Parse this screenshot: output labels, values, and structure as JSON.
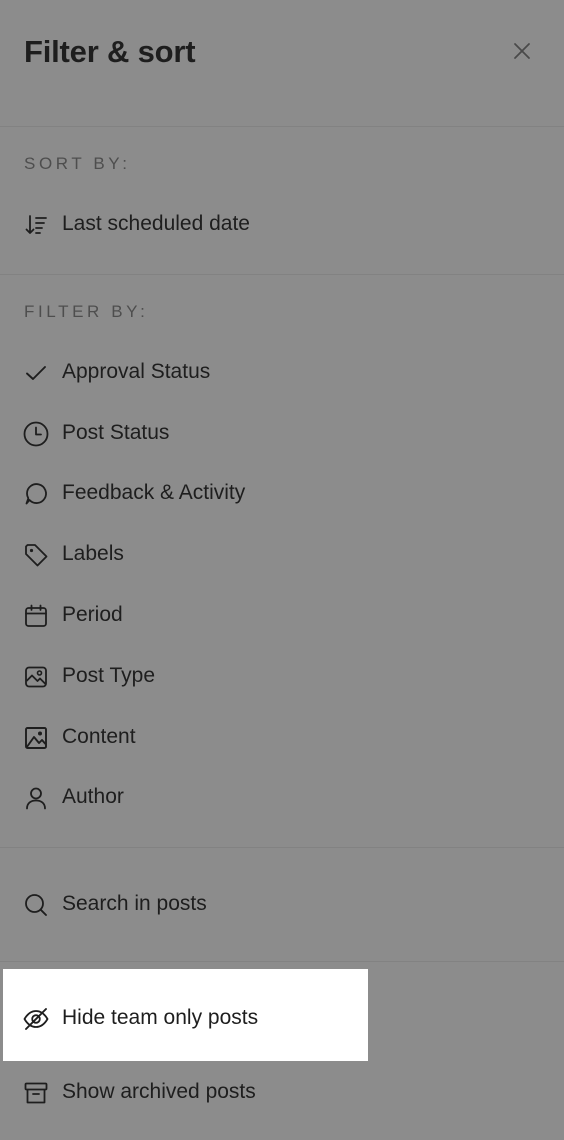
{
  "header": {
    "title": "Filter & sort",
    "close_icon": "close-icon"
  },
  "sort": {
    "label": "SORT BY:",
    "option": {
      "label": "Last scheduled date",
      "icon": "sort-descending-icon"
    }
  },
  "filter": {
    "label": "FILTER BY:",
    "items": [
      {
        "label": "Approval Status",
        "icon": "check-icon"
      },
      {
        "label": "Post Status",
        "icon": "clock-icon"
      },
      {
        "label": "Feedback & Activity",
        "icon": "comment-icon"
      },
      {
        "label": "Labels",
        "icon": "tag-icon"
      },
      {
        "label": "Period",
        "icon": "calendar-icon"
      },
      {
        "label": "Post Type",
        "icon": "image-icon"
      },
      {
        "label": "Content",
        "icon": "photo-icon"
      },
      {
        "label": "Author",
        "icon": "user-icon"
      }
    ]
  },
  "search": {
    "label": "Search in posts",
    "icon": "search-icon"
  },
  "options": {
    "hide_team_only": {
      "label": "Hide team only posts",
      "icon": "eye-off-icon"
    },
    "show_archived": {
      "label": "Show archived posts",
      "icon": "archive-icon"
    }
  }
}
